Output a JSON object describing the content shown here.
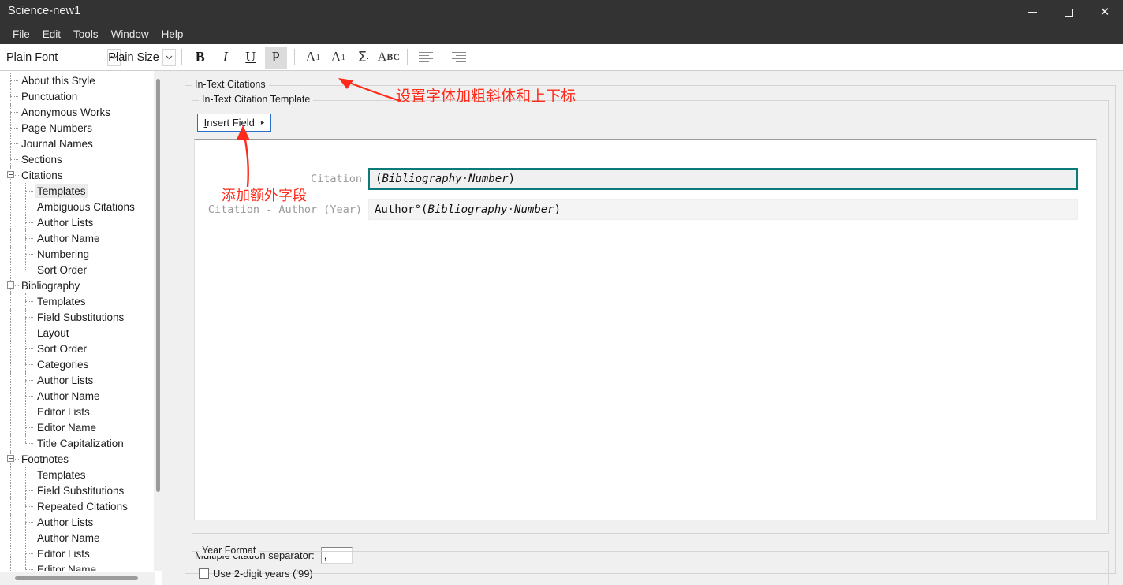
{
  "window": {
    "title": "Science-new1",
    "controls": {
      "minimize": "minimize-icon",
      "maximize": "maximize-icon",
      "close": "close-icon"
    }
  },
  "menu": {
    "items": [
      {
        "label": "File",
        "mnemonic": "F"
      },
      {
        "label": "Edit",
        "mnemonic": "E"
      },
      {
        "label": "Tools",
        "mnemonic": "T"
      },
      {
        "label": "Window",
        "mnemonic": "W"
      },
      {
        "label": "Help",
        "mnemonic": "H"
      }
    ]
  },
  "toolbar": {
    "font_combo": "Plain Font",
    "size_combo": "Plain Size",
    "bold": "B",
    "italic": "I",
    "underline": "U",
    "plain": "P",
    "superscript": "A1",
    "subscript": "A1",
    "symbol": "Σ",
    "case": "ABC",
    "align_left": "align-left-icon",
    "align_justify": "align-justify-icon"
  },
  "sidebar": {
    "items": [
      {
        "label": "About this Style",
        "level": 1,
        "expander": false,
        "selected": false
      },
      {
        "label": "Punctuation",
        "level": 1,
        "expander": false,
        "selected": false
      },
      {
        "label": "Anonymous Works",
        "level": 1,
        "expander": false,
        "selected": false
      },
      {
        "label": "Page Numbers",
        "level": 1,
        "expander": false,
        "selected": false
      },
      {
        "label": "Journal Names",
        "level": 1,
        "expander": false,
        "selected": false
      },
      {
        "label": "Sections",
        "level": 1,
        "expander": false,
        "selected": false
      },
      {
        "label": "Citations",
        "level": 1,
        "expander": true,
        "selected": false
      },
      {
        "label": "Templates",
        "level": 2,
        "expander": false,
        "selected": true
      },
      {
        "label": "Ambiguous Citations",
        "level": 2,
        "expander": false,
        "selected": false
      },
      {
        "label": "Author Lists",
        "level": 2,
        "expander": false,
        "selected": false
      },
      {
        "label": "Author Name",
        "level": 2,
        "expander": false,
        "selected": false
      },
      {
        "label": "Numbering",
        "level": 2,
        "expander": false,
        "selected": false
      },
      {
        "label": "Sort Order",
        "level": 2,
        "expander": false,
        "selected": false
      },
      {
        "label": "Bibliography",
        "level": 1,
        "expander": true,
        "selected": false
      },
      {
        "label": "Templates",
        "level": 2,
        "expander": false,
        "selected": false
      },
      {
        "label": "Field Substitutions",
        "level": 2,
        "expander": false,
        "selected": false
      },
      {
        "label": "Layout",
        "level": 2,
        "expander": false,
        "selected": false
      },
      {
        "label": "Sort Order",
        "level": 2,
        "expander": false,
        "selected": false
      },
      {
        "label": "Categories",
        "level": 2,
        "expander": false,
        "selected": false
      },
      {
        "label": "Author Lists",
        "level": 2,
        "expander": false,
        "selected": false
      },
      {
        "label": "Author Name",
        "level": 2,
        "expander": false,
        "selected": false
      },
      {
        "label": "Editor Lists",
        "level": 2,
        "expander": false,
        "selected": false
      },
      {
        "label": "Editor Name",
        "level": 2,
        "expander": false,
        "selected": false
      },
      {
        "label": "Title Capitalization",
        "level": 2,
        "expander": false,
        "selected": false
      },
      {
        "label": "Footnotes",
        "level": 1,
        "expander": true,
        "selected": false
      },
      {
        "label": "Templates",
        "level": 2,
        "expander": false,
        "selected": false
      },
      {
        "label": "Field Substitutions",
        "level": 2,
        "expander": false,
        "selected": false
      },
      {
        "label": "Repeated Citations",
        "level": 2,
        "expander": false,
        "selected": false
      },
      {
        "label": "Author Lists",
        "level": 2,
        "expander": false,
        "selected": false
      },
      {
        "label": "Author Name",
        "level": 2,
        "expander": false,
        "selected": false
      },
      {
        "label": "Editor Lists",
        "level": 2,
        "expander": false,
        "selected": false
      },
      {
        "label": "Editor Name",
        "level": 2,
        "expander": false,
        "selected": false
      }
    ]
  },
  "main": {
    "outer_group_title": "In-Text Citations",
    "template_group_title": "In-Text Citation Template",
    "insert_field_label": "Insert Field",
    "insert_field_caret": "▸",
    "rows": [
      {
        "label": "Citation",
        "value": "(Bibliography·Number)",
        "focused": true
      },
      {
        "label": "Citation - Author (Year)",
        "value": "Author°(Bibliography·Number)",
        "focused": false
      }
    ],
    "separator_label": "Multiple citation separator:",
    "separator_value": ",",
    "year_group_title": "Year Format",
    "two_digit_label": "Use 2-digit years ('99)",
    "two_digit_checked": false
  },
  "annotations": [
    {
      "text": "设置字体加粗斜体和上下标",
      "color": "#ff2a1a"
    },
    {
      "text": "添加额外字段",
      "color": "#ff2a1a"
    }
  ],
  "colors": {
    "titlebar": "#333333",
    "focus_border": "#0d7a7a",
    "button_focus": "#2a6fc9",
    "annotation": "#ff2a1a"
  }
}
